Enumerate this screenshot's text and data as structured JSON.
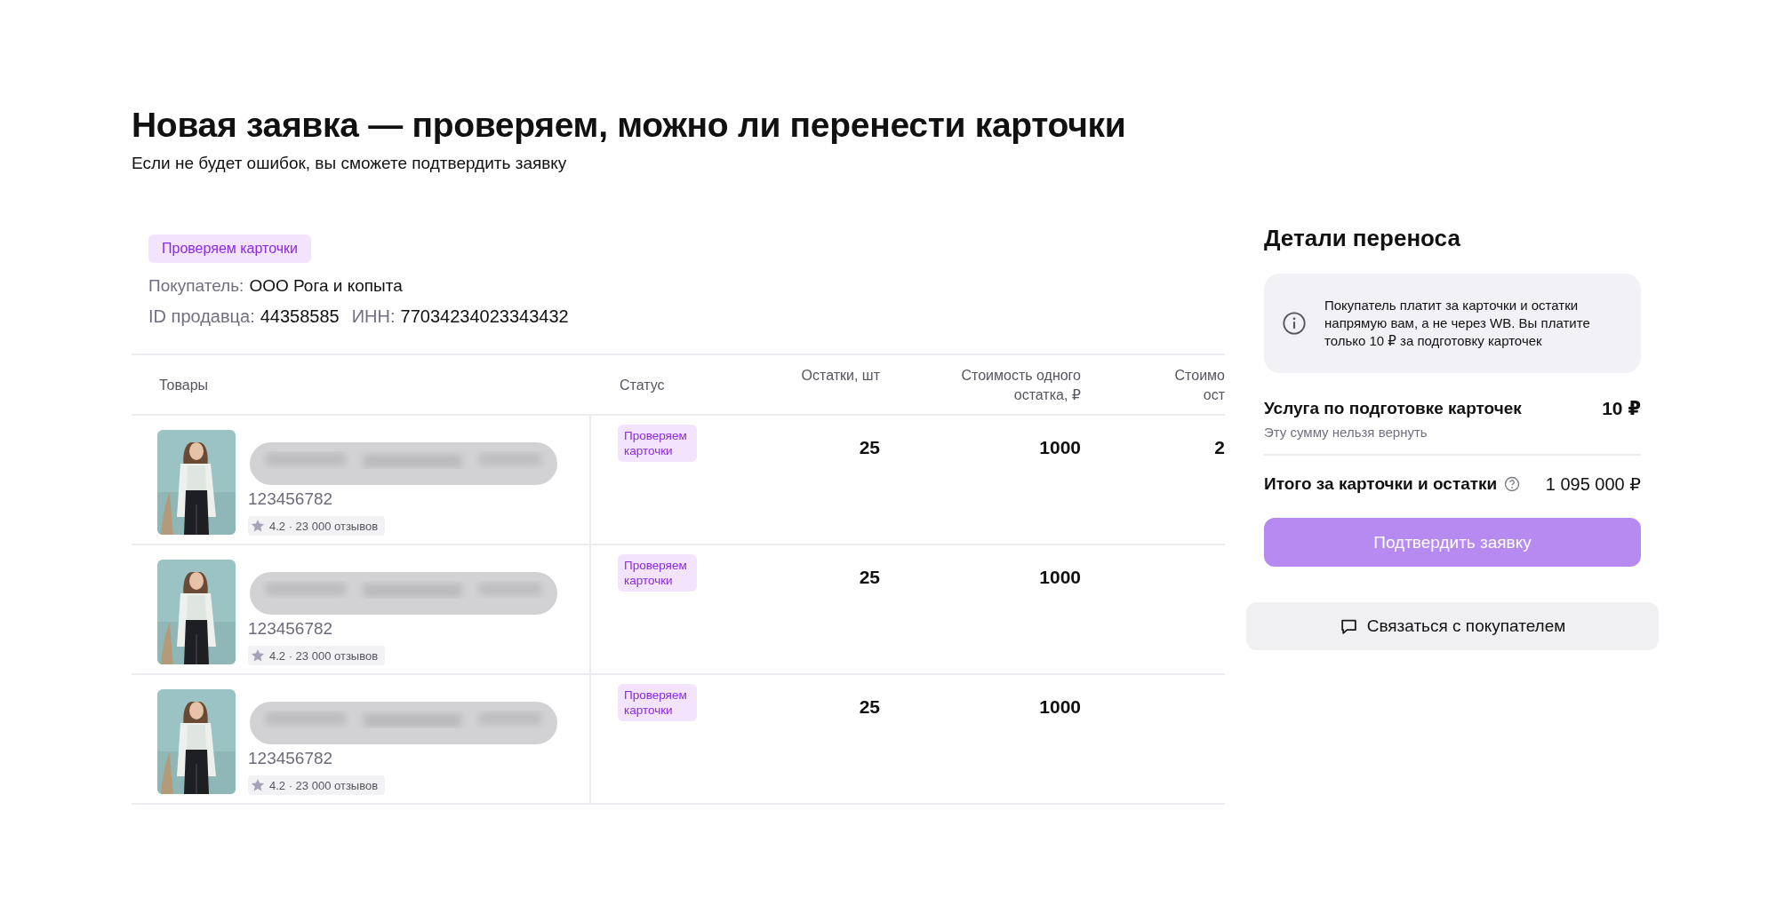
{
  "page": {
    "title": "Новая заявка — проверяем, можно ли перенести карточки",
    "subtitle": "Если не будет ошибок, вы сможете подтвердить заявку"
  },
  "request": {
    "status_badge": "Проверяем карточки",
    "buyer_label": "Покупатель:",
    "buyer": "ООО Рога и копыта",
    "seller_id_label": "ID продавца:",
    "seller_id": "44358585",
    "inn_label": "ИНН:",
    "inn": "77034234023343432"
  },
  "table": {
    "columns": [
      {
        "lines": [
          "Товары"
        ],
        "kind": "text"
      },
      {
        "lines": [
          "Статус"
        ],
        "kind": "text"
      },
      {
        "lines": [
          "Остатки, шт"
        ],
        "kind": "number"
      },
      {
        "lines": [
          "Стоимость одного",
          "остатка, ₽"
        ],
        "kind": "number"
      },
      {
        "lines": [
          "Стоимо",
          "ост"
        ],
        "kind": "number"
      }
    ],
    "rows": [
      {
        "product": {
          "kind": "picture",
          "name_blurred": true,
          "article": "123456782",
          "rating": "4.2 · 23 000 отзывов"
        },
        "status": "Проверяем карточки",
        "stock": "25",
        "unit_cost": "1000",
        "column_5": "2"
      },
      {
        "product": {
          "kind": "picture",
          "name_blurred": true,
          "article": "123456782",
          "rating": "4.2 · 23 000 отзывов"
        },
        "status": "Проверяем карточки",
        "stock": "25",
        "unit_cost": "1000"
      },
      {
        "product": {
          "kind": "picture",
          "name_blurred": true,
          "article": "123456782",
          "rating": "4.2 · 23 000 отзывов"
        },
        "status": "Проверяем карточки",
        "stock": "25",
        "unit_cost": "1000"
      }
    ]
  },
  "details": {
    "title": "Детали переноса",
    "info": "Покупатель платит за карточки и остатки напрямую вам, а не через WB. Вы платите только 10 ₽ за подготовку карточек",
    "service_label": "Услуга по подготовке карточек",
    "service_price": "10 ₽",
    "service_note": "Эту сумму нельзя вернуть",
    "total_label": "Итого за карточки и остатки",
    "total": "1 095 000 ₽",
    "confirm_button": {
      "label": "Подтвердить заявку",
      "disabled": true
    },
    "contact_button": "Связаться с покупателем"
  }
}
